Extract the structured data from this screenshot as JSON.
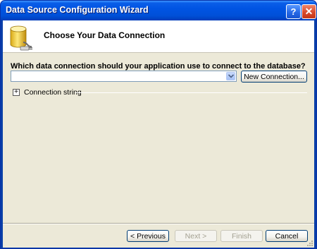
{
  "window": {
    "title": "Data Source Configuration Wizard",
    "help_icon": "help-icon",
    "help_glyph": "?",
    "close_icon": "close-icon",
    "close_glyph": "✕"
  },
  "header": {
    "title": "Choose Your Data Connection",
    "icon": "database-connection-icon"
  },
  "connection": {
    "question": "Which data connection should your application use to connect to the database?",
    "selected_value": "",
    "new_connection_label": "New Connection...",
    "expander_glyph": "+",
    "connection_string_label": "Connection string"
  },
  "footer": {
    "previous_label": "< Previous",
    "next_label": "Next >",
    "finish_label": "Finish",
    "cancel_label": "Cancel"
  },
  "colors": {
    "titlebar": "#0054e3",
    "client_background": "#ece9d8",
    "header_background": "#ffffff",
    "button_border": "#003c74",
    "disabled_text": "#a3a091"
  }
}
